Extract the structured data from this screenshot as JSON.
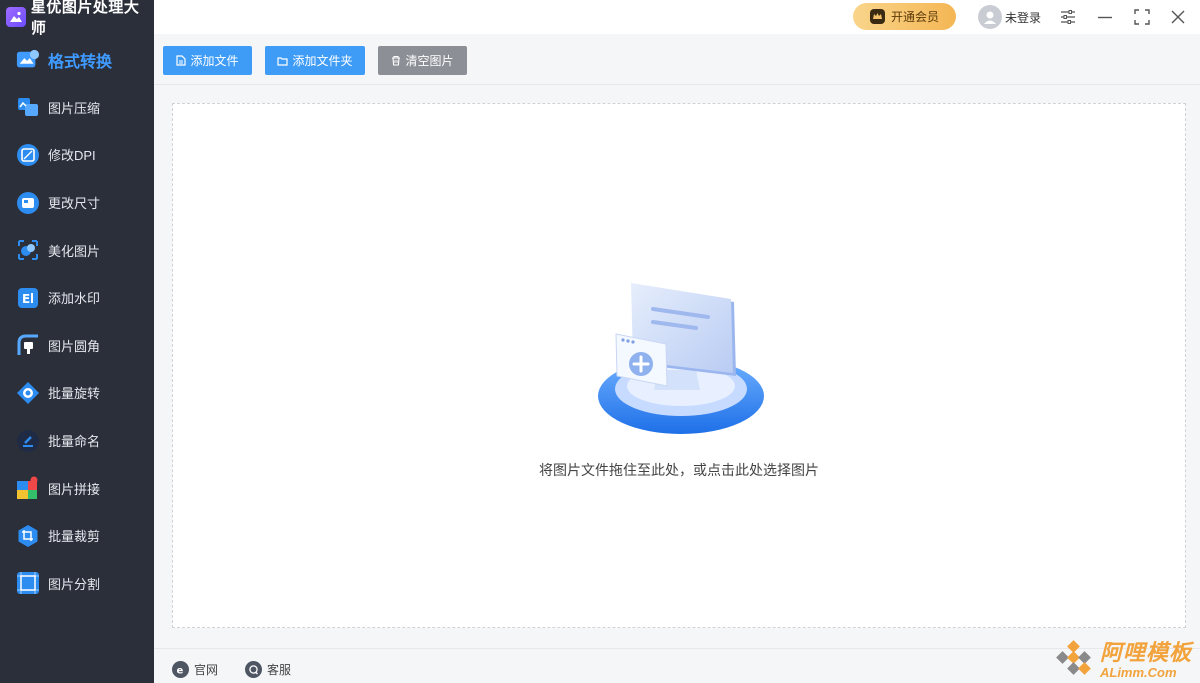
{
  "app": {
    "title": "星优图片处理大师"
  },
  "sidebar": {
    "items": [
      {
        "label": "格式转换",
        "icon": "format-convert-icon",
        "active": true
      },
      {
        "label": "图片压缩",
        "icon": "image-compress-icon"
      },
      {
        "label": "修改DPI",
        "icon": "dpi-icon"
      },
      {
        "label": "更改尺寸",
        "icon": "resize-icon"
      },
      {
        "label": "美化图片",
        "icon": "beautify-icon"
      },
      {
        "label": "添加水印",
        "icon": "watermark-icon"
      },
      {
        "label": "图片圆角",
        "icon": "round-corner-icon"
      },
      {
        "label": "批量旋转",
        "icon": "rotate-icon"
      },
      {
        "label": "批量命名",
        "icon": "rename-icon"
      },
      {
        "label": "图片拼接",
        "icon": "stitch-icon"
      },
      {
        "label": "批量裁剪",
        "icon": "crop-icon"
      },
      {
        "label": "图片分割",
        "icon": "split-icon"
      }
    ]
  },
  "header": {
    "vip_label": "开通会员",
    "user_label": "未登录"
  },
  "toolbar": {
    "add_file": "添加文件",
    "add_folder": "添加文件夹",
    "clear": "清空图片"
  },
  "dropzone": {
    "hint": "将图片文件拖住至此处，或点击此处选择图片"
  },
  "footer": {
    "website": "官网",
    "support": "客服"
  },
  "watermark": {
    "main": "阿哩模板",
    "sub": "ALimm.Com"
  },
  "colors": {
    "sidebar_bg": "#2b2f3a",
    "accent": "#3f9cf6",
    "vip": "#f4b654"
  }
}
